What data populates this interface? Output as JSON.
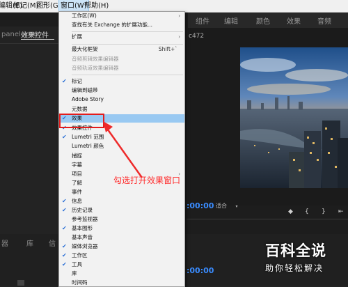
{
  "menubar": {
    "items": [
      {
        "label": "编辑(E)"
      },
      {
        "label": "标记(M)"
      },
      {
        "label": "图形(G)"
      },
      {
        "label": "窗口(W)"
      },
      {
        "label": "帮助(H)"
      }
    ]
  },
  "workspace_tabs": [
    "组件",
    "编辑",
    "颜色",
    "效果",
    "音频"
  ],
  "left_panel": {
    "tab_label": "效果控件",
    "left_icon": "panel-icon"
  },
  "monitor": {
    "clip_name": "c472",
    "fit_label": "适合"
  },
  "timecodes": {
    "program": ":00:00",
    "timeline": ":00:00"
  },
  "bottom_tabs": [
    "器",
    "库",
    "信"
  ],
  "window_menu": {
    "items": [
      {
        "label": "工作区(W)",
        "submenu": true
      },
      {
        "label": "查找有关 Exchange 的扩展功能..."
      },
      {
        "separator": true
      },
      {
        "label": "扩展",
        "submenu": true
      },
      {
        "separator": true
      },
      {
        "label": "最大化框架",
        "shortcut": "Shift+`"
      },
      {
        "label": "音频剪辑效果编辑器",
        "disabled": true
      },
      {
        "label": "音频轨道效果编辑器",
        "disabled": true
      },
      {
        "separator": true
      },
      {
        "label": "标记",
        "checked": true
      },
      {
        "label": "编辑到磁带"
      },
      {
        "label": "Adobe Story"
      },
      {
        "label": "元数据"
      },
      {
        "label": "效果",
        "checked": true,
        "highlighted": true
      },
      {
        "label": "效果控件",
        "checked": true
      },
      {
        "label": "Lumetri 范围",
        "checked": true
      },
      {
        "label": "Lumetri 颜色"
      },
      {
        "label": "捕捉"
      },
      {
        "label": "字幕"
      },
      {
        "label": "项目",
        "submenu": true
      },
      {
        "label": "了解"
      },
      {
        "label": "事件"
      },
      {
        "label": "信息",
        "checked": true
      },
      {
        "label": "历史记录",
        "checked": true
      },
      {
        "label": "参考监视器"
      },
      {
        "label": "基本图形",
        "checked": true
      },
      {
        "label": "基本声音"
      },
      {
        "label": "媒体浏览器",
        "checked": true
      },
      {
        "label": "工作区",
        "checked": true
      },
      {
        "label": "工具",
        "checked": true
      },
      {
        "label": "库"
      },
      {
        "label": "时间码"
      }
    ]
  },
  "annotation": {
    "text": "勾选打开效果窗口"
  },
  "watermark": {
    "title": "百科全说",
    "subtitle": "助你轻松解决"
  }
}
